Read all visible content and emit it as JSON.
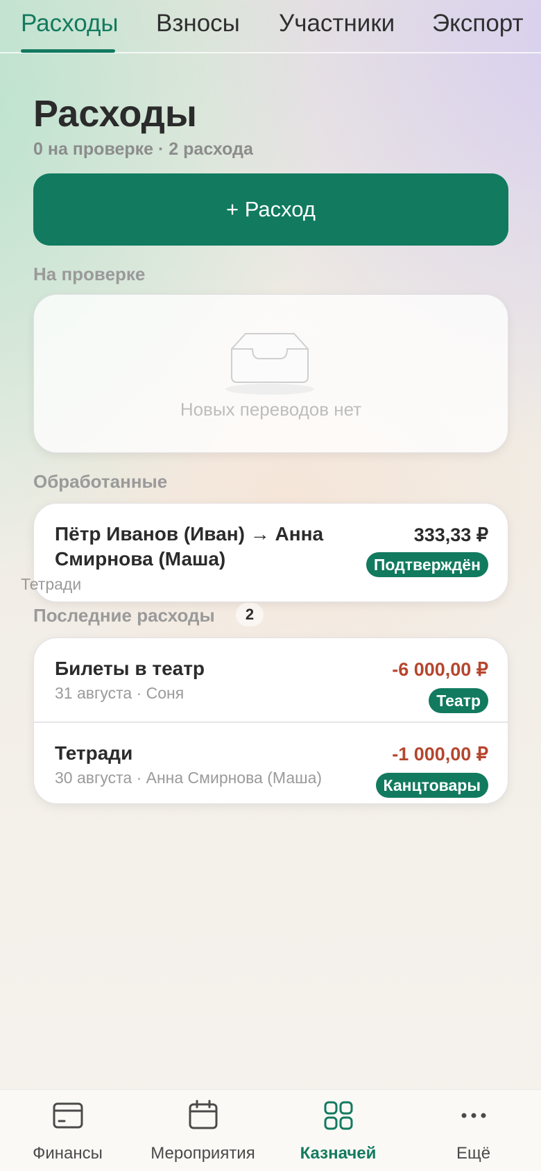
{
  "tabs": [
    {
      "label": "Расходы",
      "active": true
    },
    {
      "label": "Взносы",
      "active": false
    },
    {
      "label": "Участники",
      "active": false
    },
    {
      "label": "Экспорт",
      "active": false
    }
  ],
  "header": {
    "title": "Расходы",
    "subtitle": "0 на проверке · 2 расхода"
  },
  "add_button": {
    "label": "+ Расход"
  },
  "review_section": {
    "label": "На проверке",
    "empty_text": "Новых переводов нет",
    "icon": "inbox-icon"
  },
  "processed_section": {
    "label": "Обработанные",
    "items": [
      {
        "title": "Пётр Иванов (Иван) → Анна Смирнова (Маша)",
        "subtitle": "Тетради",
        "amount": "333,33 ₽",
        "status": "Подтверждён"
      }
    ]
  },
  "recent_section": {
    "label": "Последние расходы",
    "count": "2",
    "items": [
      {
        "title": "Билеты в театр",
        "subtitle": "31 августа · Соня",
        "amount": "-6 000,00 ₽",
        "category": "Театр"
      },
      {
        "title": "Тетради",
        "subtitle": "30 августа · Анна Смирнова (Маша)",
        "amount": "-1 000,00 ₽",
        "category": "Канцтовары"
      }
    ]
  },
  "bottom_nav": [
    {
      "label": "Финансы",
      "icon": "card-icon",
      "active": false
    },
    {
      "label": "Мероприятия",
      "icon": "calendar-icon",
      "active": false
    },
    {
      "label": "Казначей",
      "icon": "grid-icon",
      "active": true
    },
    {
      "label": "Ещё",
      "icon": "more-icon",
      "active": false
    }
  ],
  "colors": {
    "accent": "#117a5f",
    "negative_amount": "#b5462e",
    "muted_text": "#9a9a9a"
  }
}
